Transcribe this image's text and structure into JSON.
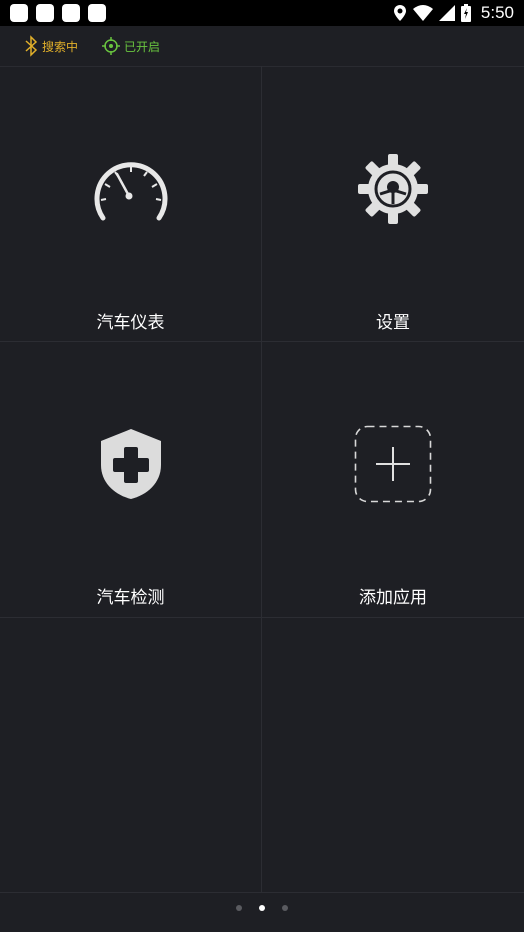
{
  "status_bar": {
    "time": "5:50"
  },
  "top_bar": {
    "bluetooth_label": "搜索中",
    "gps_label": "已开启"
  },
  "grid": {
    "items": [
      {
        "label": "汽车仪表",
        "icon": "speedometer-icon"
      },
      {
        "label": "设置",
        "icon": "gear-steering-icon"
      },
      {
        "label": "汽车检测",
        "icon": "shield-plus-icon"
      },
      {
        "label": "添加应用",
        "icon": "add-app-icon"
      }
    ]
  },
  "pager": {
    "pages": 3,
    "active": 2
  },
  "colors": {
    "background": "#1e1f24",
    "bluetooth": "#e2b02a",
    "gps": "#69c43f"
  }
}
